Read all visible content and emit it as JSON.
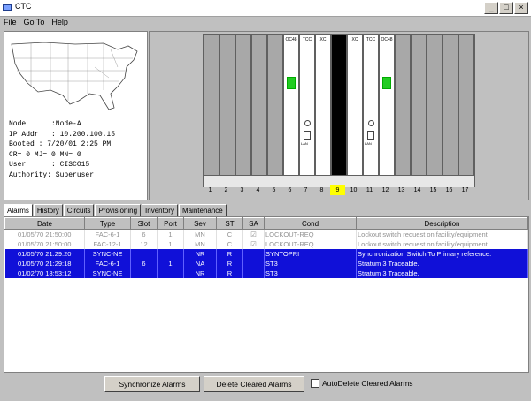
{
  "window": {
    "title": "CTC",
    "minimize": "_",
    "maximize": "□",
    "close": "×"
  },
  "menu": [
    {
      "underline": "F",
      "rest": "ile"
    },
    {
      "underline": "G",
      "rest": "o To"
    },
    {
      "underline": "H",
      "rest": "elp"
    }
  ],
  "node_info": {
    "node": "Node      :Node-A",
    "ip": "IP Addr   : 10.200.100.15",
    "booted": "Booted : 7/20/01 2:25 PM",
    "counts": "CR= 0 MJ= 0 MN= 0",
    "user": "User      : CISCO15",
    "authority": "Authority: Superuser"
  },
  "shelf": {
    "cards": {
      "c6": "OC48",
      "c7": "TCC",
      "c8": "XC",
      "c10": "XC",
      "c11": "TCC",
      "c12": "OC48",
      "lan": "LAN"
    },
    "slot_numbers": [
      "1",
      "2",
      "3",
      "4",
      "5",
      "6",
      "7",
      "8",
      "9",
      "10",
      "11",
      "12",
      "13",
      "14",
      "15",
      "16",
      "17"
    ],
    "selected_slot": "9"
  },
  "tabs": [
    "Alarms",
    "History",
    "Circuits",
    "Provisioning",
    "Inventory",
    "Maintenance"
  ],
  "alarms": {
    "columns": [
      "Date",
      "Type",
      "Slot",
      "Port",
      "Sev",
      "ST",
      "SA",
      "Cond",
      "Description"
    ],
    "rows": [
      {
        "date": "01/05/70 21:50:00",
        "type": "FAC-6-1",
        "slot": "6",
        "port": "1",
        "sev": "MN",
        "st": "C",
        "sa": "☑",
        "cond": "LOCKOUT-REQ",
        "desc": "Lockout switch request on facility/equipment",
        "state": "cleared"
      },
      {
        "date": "01/05/70 21:50:00",
        "type": "FAC-12-1",
        "slot": "12",
        "port": "1",
        "sev": "MN",
        "st": "C",
        "sa": "☑",
        "cond": "LOCKOUT-REQ",
        "desc": "Lockout switch request on facility/equipment",
        "state": "cleared"
      },
      {
        "date": "01/05/70 21:29:20",
        "type": "SYNC-NE",
        "slot": "",
        "port": "",
        "sev": "NR",
        "st": "R",
        "sa": "",
        "cond": "SYNTOPRI",
        "desc": "Synchronization Switch To Primary reference.",
        "state": "raised"
      },
      {
        "date": "01/05/70 21:29:18",
        "type": "FAC-6-1",
        "slot": "6",
        "port": "1",
        "sev": "NA",
        "st": "R",
        "sa": "",
        "cond": "ST3",
        "desc": "Stratum 3 Traceable.",
        "state": "raised"
      },
      {
        "date": "01/02/70 18:53:12",
        "type": "SYNC-NE",
        "slot": "",
        "port": "",
        "sev": "NR",
        "st": "R",
        "sa": "",
        "cond": "ST3",
        "desc": "Stratum 3 Traceable.",
        "state": "raised"
      }
    ]
  },
  "buttons": {
    "sync": "Synchronize Alarms",
    "delete": "Delete Cleared Alarms",
    "autodelete": "AutoDelete Cleared Alarms"
  }
}
